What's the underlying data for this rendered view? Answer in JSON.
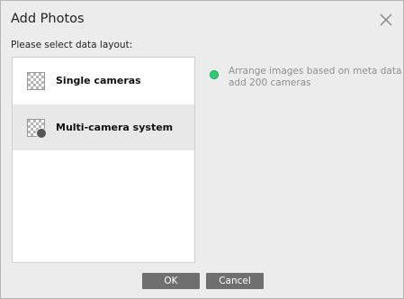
{
  "dialog": {
    "title": "Add Photos",
    "close_icon": "close-icon"
  },
  "prompt": "Please select data layout:",
  "layouts": [
    {
      "label": "Single cameras",
      "icon": "checker-icon",
      "selected": false
    },
    {
      "label": "Multi-camera system",
      "icon": "checker-multi-icon",
      "selected": true
    }
  ],
  "status": {
    "line1": "Arrange images based on meta data",
    "line2": "add 200 cameras",
    "color": "#2ecc71"
  },
  "buttons": {
    "ok_label": "OK",
    "cancel_label": "Cancel"
  }
}
